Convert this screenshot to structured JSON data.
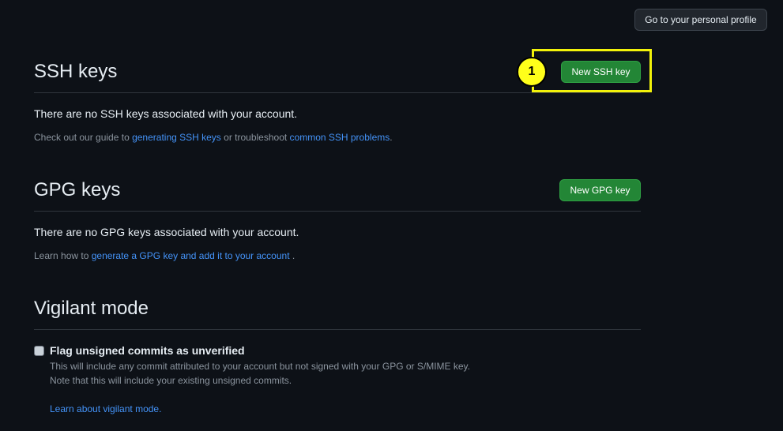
{
  "header": {
    "profile_button": "Go to your personal profile"
  },
  "ssh": {
    "title": "SSH keys",
    "new_button": "New SSH key",
    "empty_text": "There are no SSH keys associated with your account.",
    "note_prefix": "Check out our guide to ",
    "note_link1": "generating SSH keys",
    "note_middle": " or troubleshoot ",
    "note_link2": "common SSH problems",
    "note_suffix": "."
  },
  "gpg": {
    "title": "GPG keys",
    "new_button": "New GPG key",
    "empty_text": "There are no GPG keys associated with your account.",
    "note_prefix": "Learn how to ",
    "note_link": "generate a GPG key and add it to your account",
    "note_suffix": " ."
  },
  "vigilant": {
    "title": "Vigilant mode",
    "checkbox_label": "Flag unsigned commits as unverified",
    "checked": false,
    "description_line1": "This will include any commit attributed to your account but not signed with your GPG or S/MIME key.",
    "description_line2": "Note that this will include your existing unsigned commits.",
    "learn_link": "Learn about vigilant mode."
  },
  "annotation": {
    "marker_label": "1",
    "highlight_color": "#f2f20a"
  },
  "colors": {
    "background": "#0d1117",
    "primary_button": "#238636",
    "link": "#4493f8",
    "muted_text": "#8b949e"
  }
}
